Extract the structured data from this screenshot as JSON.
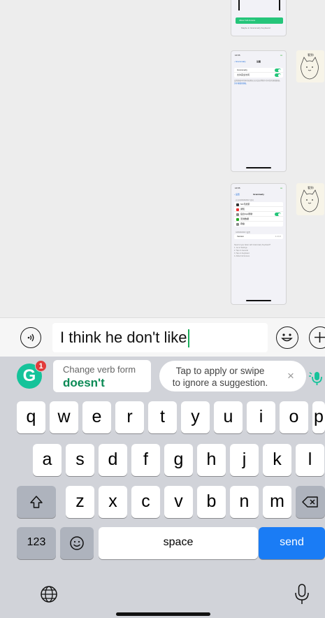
{
  "chat": {
    "thumb1": {
      "button_label": "Allow Full Access",
      "sub_text": "Maybe in Grammarly Keyboard"
    },
    "thumb2": {
      "time": "16:55",
      "back": "Grammarly",
      "title": "设置",
      "rows": [
        "Grammarly",
        "允许完全访问"
      ],
      "note": "设置面板中打开的权限仅允许此应用程序访问您的键盘数据。",
      "note_link": "关于键盘的隐私"
    },
    "thumb3": {
      "time": "16:55",
      "back": "设置",
      "title": "Grammarly",
      "section1": "允许GRAMMARLY访问",
      "rows": [
        {
          "label": "Siri与搜索",
          "value": ""
        },
        {
          "label": "通知",
          "value": ""
        },
        {
          "label": "后台App刷新",
          "value": ""
        },
        {
          "label": "无线数据",
          "value": ""
        },
        {
          "label": "键盘",
          "value": ""
        }
      ],
      "section2": "GRAMMARLY设置",
      "version_label": "Version",
      "version_value": "2.24.0",
      "notes": [
        "Need to type faster with Grammarly Keyboard?",
        "1. Go to Settings",
        "2. Tap on General",
        "3. Tap on Keyboard",
        "4. Allow Full Access"
      ]
    },
    "sticker_caption": "看到!"
  },
  "input": {
    "text": "I think he don't like"
  },
  "keyboard": {
    "grammarly_badge": "1",
    "grammarly_logo": "G",
    "suggestion_title": "Change verb form",
    "suggestion_value": "doesn't",
    "hint_line1": "Tap to apply or swipe",
    "hint_line2": "to ignore a suggestion.",
    "close": "×",
    "row1": [
      "q",
      "w",
      "e",
      "r",
      "t",
      "y",
      "u",
      "i",
      "o",
      "p"
    ],
    "row2": [
      "a",
      "s",
      "d",
      "f",
      "g",
      "h",
      "j",
      "k",
      "l"
    ],
    "row3": [
      "z",
      "x",
      "c",
      "v",
      "b",
      "n",
      "m"
    ],
    "numbers_label": "123",
    "space_label": "space",
    "send_label": "send"
  },
  "colors": {
    "send_blue": "#1a7cf5",
    "grammarly_green": "#15c39a",
    "suggestion_green": "#0b8a55",
    "badge_red": "#e23b3b",
    "key_gray": "#aeb3bd"
  }
}
